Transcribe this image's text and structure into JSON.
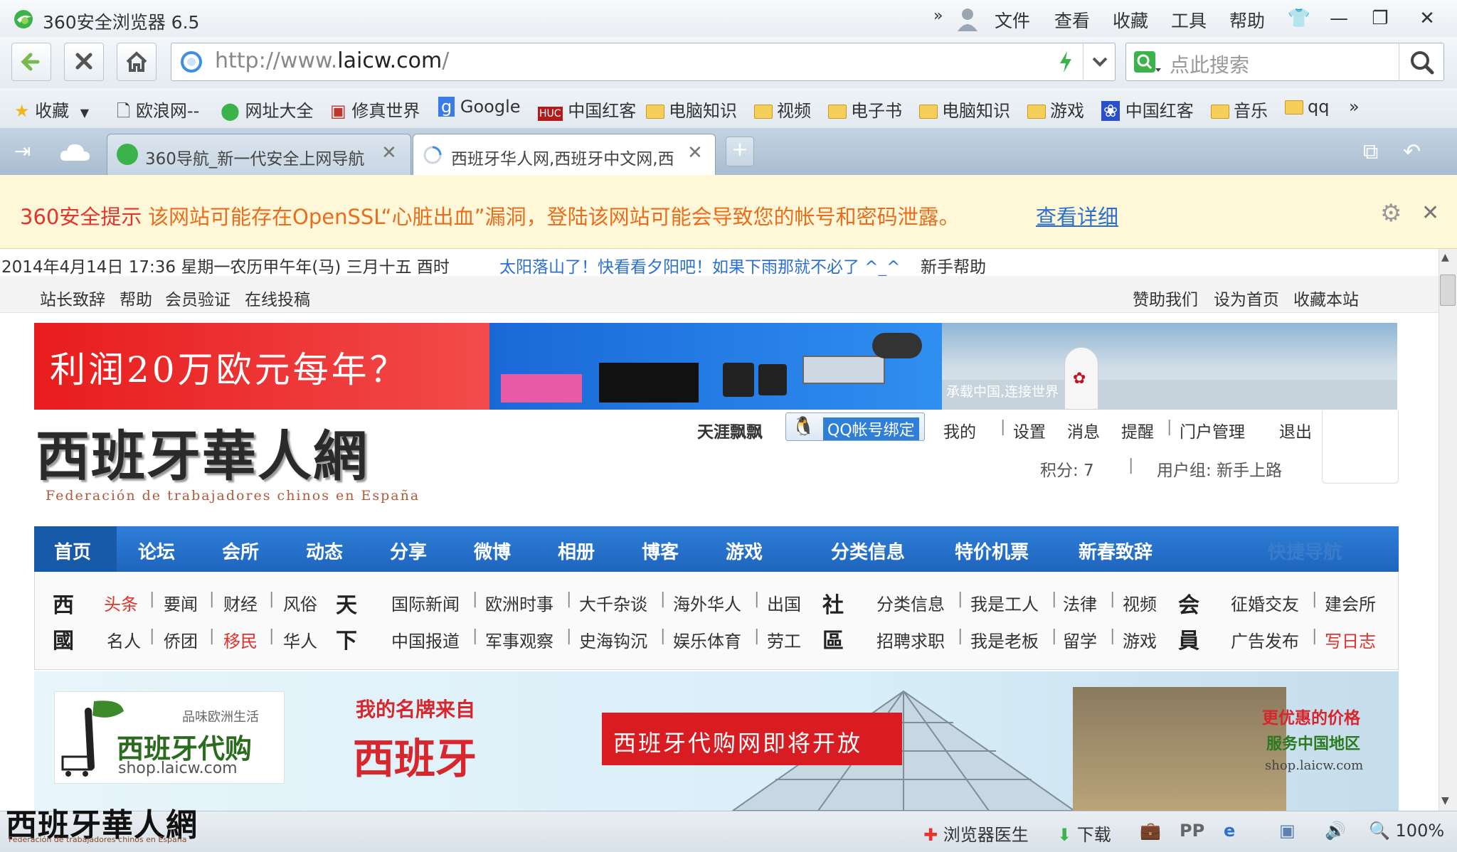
{
  "window": {
    "title": "360安全浏览器 6.5",
    "menu": [
      "文件",
      "查看",
      "收藏",
      "工具",
      "帮助"
    ],
    "overflow_chevron": "»"
  },
  "toolbar": {
    "url_prefix": "http://www.",
    "url_domain": "laicw.com",
    "url_suffix": "/",
    "search_placeholder": "点此搜索"
  },
  "bookmarks": {
    "favorites_label": "收藏",
    "items": [
      "欧浪网--",
      "网址大全",
      "修真世界",
      "Google",
      "中国红客",
      "电脑知识",
      "视频",
      "电子书",
      "电脑知识",
      "游戏",
      "中国红客",
      "音乐",
      "qq"
    ],
    "more": "»"
  },
  "tabs": [
    {
      "label": "360导航_新一代安全上网导航"
    },
    {
      "label": "西班牙华人网,西班牙中文网,西"
    }
  ],
  "warning": {
    "strong": "360安全提示",
    "message": "该网站可能存在OpenSSL“心脏出血”漏洞，登陆该网站可能会导致您的帐号和密码泄露。",
    "link": "查看详细"
  },
  "page": {
    "datetime": "2014年4月14日 17:36 星期一农历甲午年(马) 三月十五 酉时",
    "marquee": "太阳落山了！快看看夕阳吧！如果下雨那就不必了 ^_^",
    "help": "新手帮助",
    "top_links_left": [
      "站长致辞",
      "帮助",
      "会员验证",
      "在线投稿"
    ],
    "top_links_right": [
      "赞助我们",
      "设为首页",
      "收藏本站"
    ],
    "banners": {
      "profit": "利润20万欧元每年？",
      "airport": "承载中国,连接世界"
    },
    "logo": {
      "title": "西班牙華人網",
      "subtitle": "Federación de trabajadores chinos en España"
    },
    "user": {
      "name": "天涯飘飘",
      "qq_bind": "QQ帐号绑定",
      "links": [
        "我的",
        "设置",
        "消息",
        "提醒",
        "门户管理",
        "退出"
      ],
      "points": "积分: 7",
      "group": "用户组: 新手上路"
    },
    "nav": [
      "首页",
      "论坛",
      "会所",
      "动态",
      "分享",
      "微博",
      "相册",
      "博客",
      "游戏",
      "分类信息",
      "特价机票",
      "新春致辞",
      "快捷导航"
    ],
    "subnav": {
      "region1": [
        "西",
        "國"
      ],
      "row1a": [
        "头条",
        "要闻",
        "财经",
        "风俗"
      ],
      "row2a": [
        "名人",
        "侨团",
        "移民",
        "华人"
      ],
      "region2": [
        "天",
        "下"
      ],
      "row1b": [
        "国际新闻",
        "欧洲时事",
        "大千杂谈",
        "海外华人",
        "出国"
      ],
      "row2b": [
        "中国报道",
        "军事观察",
        "史海钩沉",
        "娱乐体育",
        "劳工"
      ],
      "region3": [
        "社",
        "區"
      ],
      "row1c": [
        "分类信息",
        "我是工人",
        "法律",
        "视频"
      ],
      "row2c": [
        "招聘求职",
        "我是老板",
        "留学",
        "游戏"
      ],
      "region4": [
        "会",
        "員"
      ],
      "row1d": [
        "征婚交友",
        "建会所"
      ],
      "row2d": [
        "广告发布",
        "写日志"
      ]
    },
    "promo": {
      "tagline": "品味欧洲生活",
      "brand": "西班牙代购",
      "domain": "shop.laicw.com",
      "origin_label": "我的名牌来自",
      "origin": "西班牙",
      "launch": "西班牙代购网即将开放",
      "right_line1": "更优惠的价格",
      "right_line2": "服务中国地区",
      "right_line3": "shop.laicw.com"
    }
  },
  "statusbar": {
    "doctor": "浏览器医生",
    "download": "下载",
    "zoom": "100%"
  },
  "watermark": {
    "title": "西班牙華人網",
    "subtitle": "Federación de trabajadores chinos en España"
  }
}
